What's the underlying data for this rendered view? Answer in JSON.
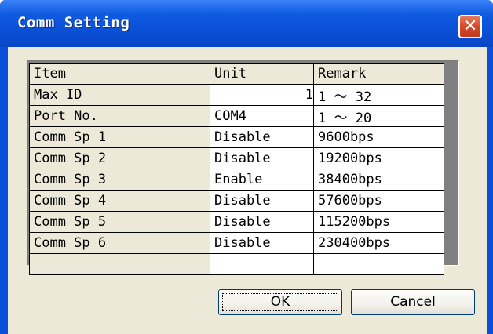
{
  "window": {
    "title": "Comm Setting",
    "close_glyph": "✕"
  },
  "grid": {
    "headers": [
      "Item",
      "Unit",
      "Remark"
    ],
    "rows": [
      {
        "item": "Max ID",
        "unit": "1",
        "remark": "1 ～ 32"
      },
      {
        "item": "Port No.",
        "unit": "COM4",
        "remark": "1 ～ 20"
      },
      {
        "item": "Comm Sp 1",
        "unit": "Disable",
        "remark": "9600bps"
      },
      {
        "item": "Comm Sp 2",
        "unit": "Disable",
        "remark": "19200bps"
      },
      {
        "item": "Comm Sp 3",
        "unit": "Enable",
        "remark": "38400bps"
      },
      {
        "item": "Comm Sp 4",
        "unit": "Disable",
        "remark": "57600bps"
      },
      {
        "item": "Comm Sp 5",
        "unit": "Disable",
        "remark": "115200bps"
      },
      {
        "item": "Comm Sp 6",
        "unit": "Disable",
        "remark": "230400bps"
      }
    ]
  },
  "buttons": {
    "ok_label": "OK",
    "cancel_label": "Cancel"
  },
  "colors": {
    "titlebar": "#0a4ed4",
    "close": "#d6482a",
    "dialog_bg": "#ece9d8",
    "grid_bg": "#808080"
  }
}
